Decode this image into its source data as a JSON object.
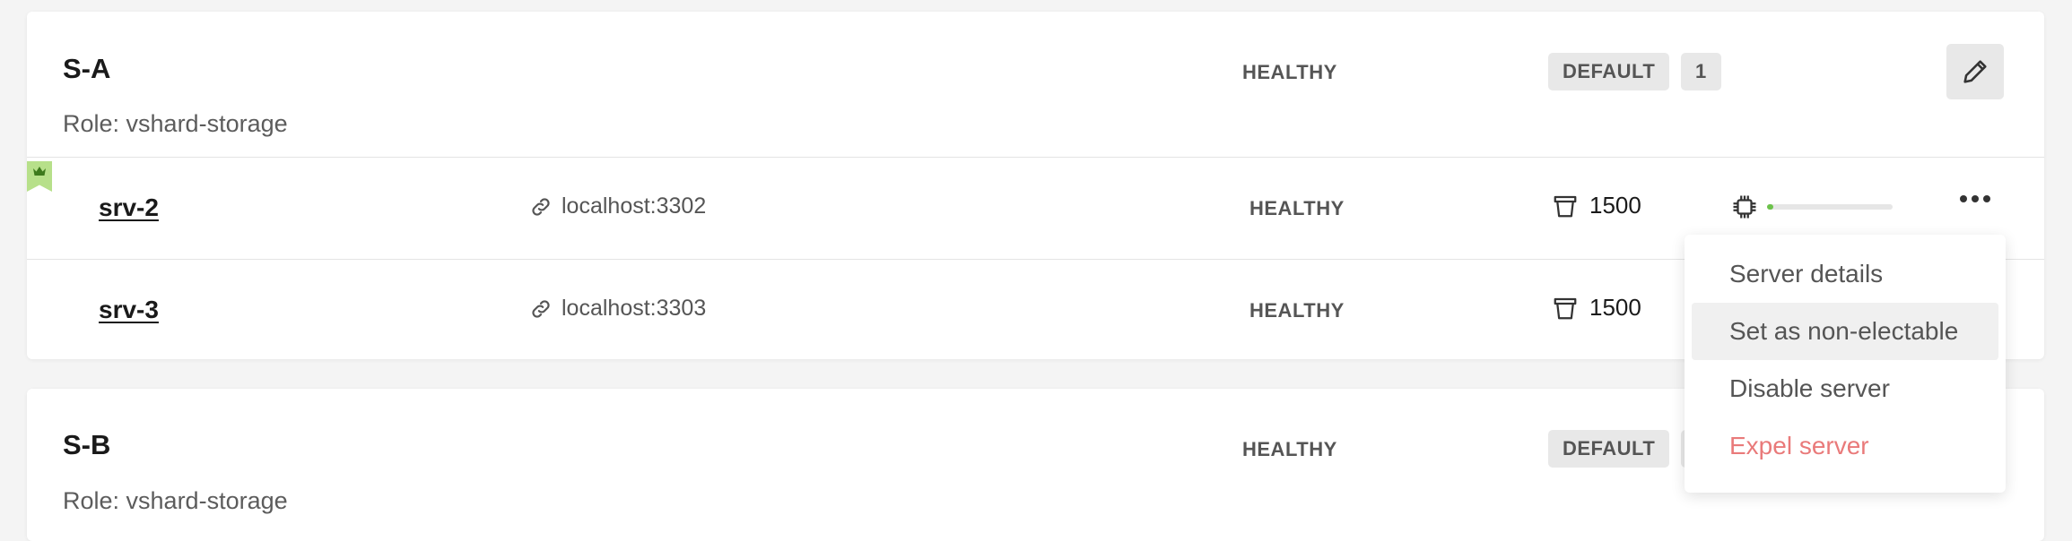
{
  "replicasets": [
    {
      "name": "S-A",
      "role": "Role: vshard-storage",
      "status": "HEALTHY",
      "group_badge": "DEFAULT",
      "weight_badge": "1",
      "servers": [
        {
          "name": "srv-2",
          "uri": "localhost:3302",
          "status": "HEALTHY",
          "buckets": "1500",
          "leader": true,
          "memory_fraction": 0.04
        },
        {
          "name": "srv-3",
          "uri": "localhost:3303",
          "status": "HEALTHY",
          "buckets": "1500",
          "leader": false
        }
      ]
    },
    {
      "name": "S-B",
      "role": "Role: vshard-storage",
      "status": "HEALTHY",
      "group_badge": "DEFAULT"
    }
  ],
  "server_menu": {
    "items": [
      "Server details",
      "Set as non-electable",
      "Disable server",
      "Expel server"
    ],
    "highlighted_index": 1,
    "danger_color": "#e97a7a"
  },
  "icons": {
    "edit": "pencil-icon",
    "uri": "link-icon",
    "buckets": "bucket-icon",
    "memory": "chip-icon",
    "more": "more-dots-icon",
    "leader": "crown-icon"
  },
  "colors": {
    "leader_flag": "#b7e08a",
    "memory_fill": "#6cc24a"
  }
}
